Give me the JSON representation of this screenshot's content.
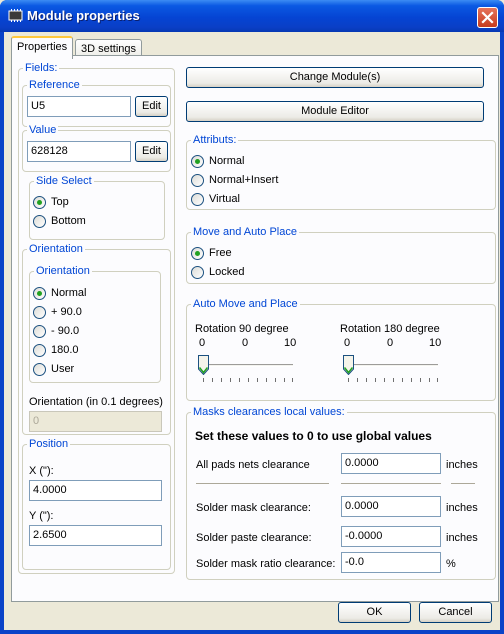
{
  "window": {
    "title": "Module properties",
    "close_icon": "close-icon",
    "app_icon": "module-icon"
  },
  "tabs": [
    {
      "label": "Properties",
      "active": true
    },
    {
      "label": "3D settings",
      "active": false
    }
  ],
  "fields": {
    "title": "Fields:",
    "reference": {
      "title": "Reference",
      "value": "U5",
      "edit_label": "Edit"
    },
    "value": {
      "title": "Value",
      "value": "628128",
      "edit_label": "Edit"
    }
  },
  "side_select": {
    "title": "Side Select",
    "options": [
      {
        "label": "Top",
        "selected": true
      },
      {
        "label": "Bottom",
        "selected": false
      }
    ]
  },
  "orientation": {
    "title": "Orientation",
    "inner_title": "Orientation",
    "options": [
      {
        "label": "Normal",
        "selected": true
      },
      {
        "label": "+ 90.0",
        "selected": false
      },
      {
        "label": "- 90.0",
        "selected": false
      },
      {
        "label": "180.0",
        "selected": false
      },
      {
        "label": "User",
        "selected": false
      }
    ],
    "user_label": "Orientation (in 0.1 degrees)",
    "user_value": "0"
  },
  "position": {
    "title": "Position",
    "x_label": "X (\"):",
    "x_value": "4.0000",
    "y_label": "Y (\"):",
    "y_value": "2.6500"
  },
  "buttons": {
    "change_module": "Change Module(s)",
    "module_editor": "Module Editor"
  },
  "attributs": {
    "title": "Attributs:",
    "options": [
      {
        "label": "Normal",
        "selected": true
      },
      {
        "label": "Normal+Insert",
        "selected": false
      },
      {
        "label": "Virtual",
        "selected": false
      }
    ]
  },
  "move_place": {
    "title": "Move and Auto Place",
    "options": [
      {
        "label": "Free",
        "selected": true
      },
      {
        "label": "Locked",
        "selected": false
      }
    ]
  },
  "auto_move": {
    "title": "Auto Move and Place",
    "rot90": {
      "label": "Rotation 90 degree",
      "min": "0",
      "current": "0",
      "max": "10",
      "value": 0
    },
    "rot180": {
      "label": "Rotation 180 degree",
      "min": "0",
      "current": "0",
      "max": "10",
      "value": 0
    }
  },
  "masks": {
    "title": "Masks clearances local values:",
    "note": "Set these values to 0 to use global values",
    "rows": [
      {
        "label": "All pads nets clearance",
        "value": "0.0000",
        "unit": "inches"
      },
      {
        "label": "Solder mask clearance:",
        "value": "0.0000",
        "unit": "inches"
      },
      {
        "label": "Solder paste clearance:",
        "value": "-0.0000",
        "unit": "inches"
      },
      {
        "label": "Solder mask ratio clearance:",
        "value": "-0.0",
        "unit": "%"
      }
    ]
  },
  "footer": {
    "ok_label": "OK",
    "cancel_label": "Cancel"
  }
}
